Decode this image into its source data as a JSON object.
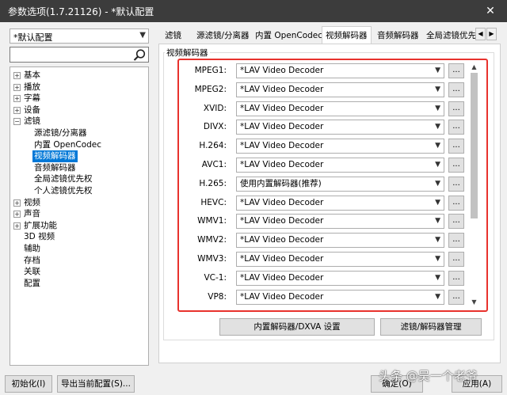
{
  "window": {
    "title": "参数选项(1.7.21126) - *默认配置",
    "close_glyph": "✕"
  },
  "sidebar": {
    "profile_value": "*默认配置",
    "tree": [
      {
        "label": "基本",
        "level": 0,
        "expander": "+"
      },
      {
        "label": "播放",
        "level": 0,
        "expander": "+"
      },
      {
        "label": "字幕",
        "level": 0,
        "expander": "+"
      },
      {
        "label": "设备",
        "level": 0,
        "expander": "+"
      },
      {
        "label": "滤镜",
        "level": 0,
        "expander": "−"
      },
      {
        "label": "源滤镜/分离器",
        "level": 1
      },
      {
        "label": "内置 OpenCodec",
        "level": 1
      },
      {
        "label": "视频解码器",
        "level": 1,
        "selected": true
      },
      {
        "label": "音频解码器",
        "level": 1
      },
      {
        "label": "全局滤镜优先权",
        "level": 1
      },
      {
        "label": "个人滤镜优先权",
        "level": 1
      },
      {
        "label": "视频",
        "level": 0,
        "expander": "+"
      },
      {
        "label": "声音",
        "level": 0,
        "expander": "+"
      },
      {
        "label": "扩展功能",
        "level": 0,
        "expander": "+"
      },
      {
        "label": "3D 视频",
        "level": 0
      },
      {
        "label": "辅助",
        "level": 0
      },
      {
        "label": "存档",
        "level": 0
      },
      {
        "label": "关联",
        "level": 0
      },
      {
        "label": "配置",
        "level": 0
      }
    ]
  },
  "tabs": [
    "滤镜",
    "源滤镜/分离器",
    "内置 OpenCodec",
    "视频解码器",
    "音频解码器",
    "全局滤镜优先"
  ],
  "active_tab": 3,
  "group": {
    "label": "视频解码器",
    "rows": [
      {
        "codec": "MPEG1:",
        "decoder": "*LAV Video Decoder"
      },
      {
        "codec": "MPEG2:",
        "decoder": "*LAV Video Decoder"
      },
      {
        "codec": "XVID:",
        "decoder": "*LAV Video Decoder"
      },
      {
        "codec": "DIVX:",
        "decoder": "*LAV Video Decoder"
      },
      {
        "codec": "H.264:",
        "decoder": "*LAV Video Decoder"
      },
      {
        "codec": "AVC1:",
        "decoder": "*LAV Video Decoder"
      },
      {
        "codec": "H.265:",
        "decoder": "使用内置解码器(推荐)"
      },
      {
        "codec": "HEVC:",
        "decoder": "*LAV Video Decoder"
      },
      {
        "codec": "WMV1:",
        "decoder": "*LAV Video Decoder"
      },
      {
        "codec": "WMV2:",
        "decoder": "*LAV Video Decoder"
      },
      {
        "codec": "WMV3:",
        "decoder": "*LAV Video Decoder"
      },
      {
        "codec": "VC-1:",
        "decoder": "*LAV Video Decoder"
      },
      {
        "codec": "VP8:",
        "decoder": "*LAV Video Decoder"
      }
    ],
    "more_label": "...",
    "builtin_dxva_button": "内置解码器/DXVA 设置",
    "filter_manage_button": "滤镜/解码器管理"
  },
  "footer": {
    "init_button": "初始化(I)",
    "export_button": "导出当前配置(S)...",
    "ok_button": "确定(O)",
    "apply_button": "应用(A)"
  },
  "watermark": "头条 @吴一个老爷"
}
